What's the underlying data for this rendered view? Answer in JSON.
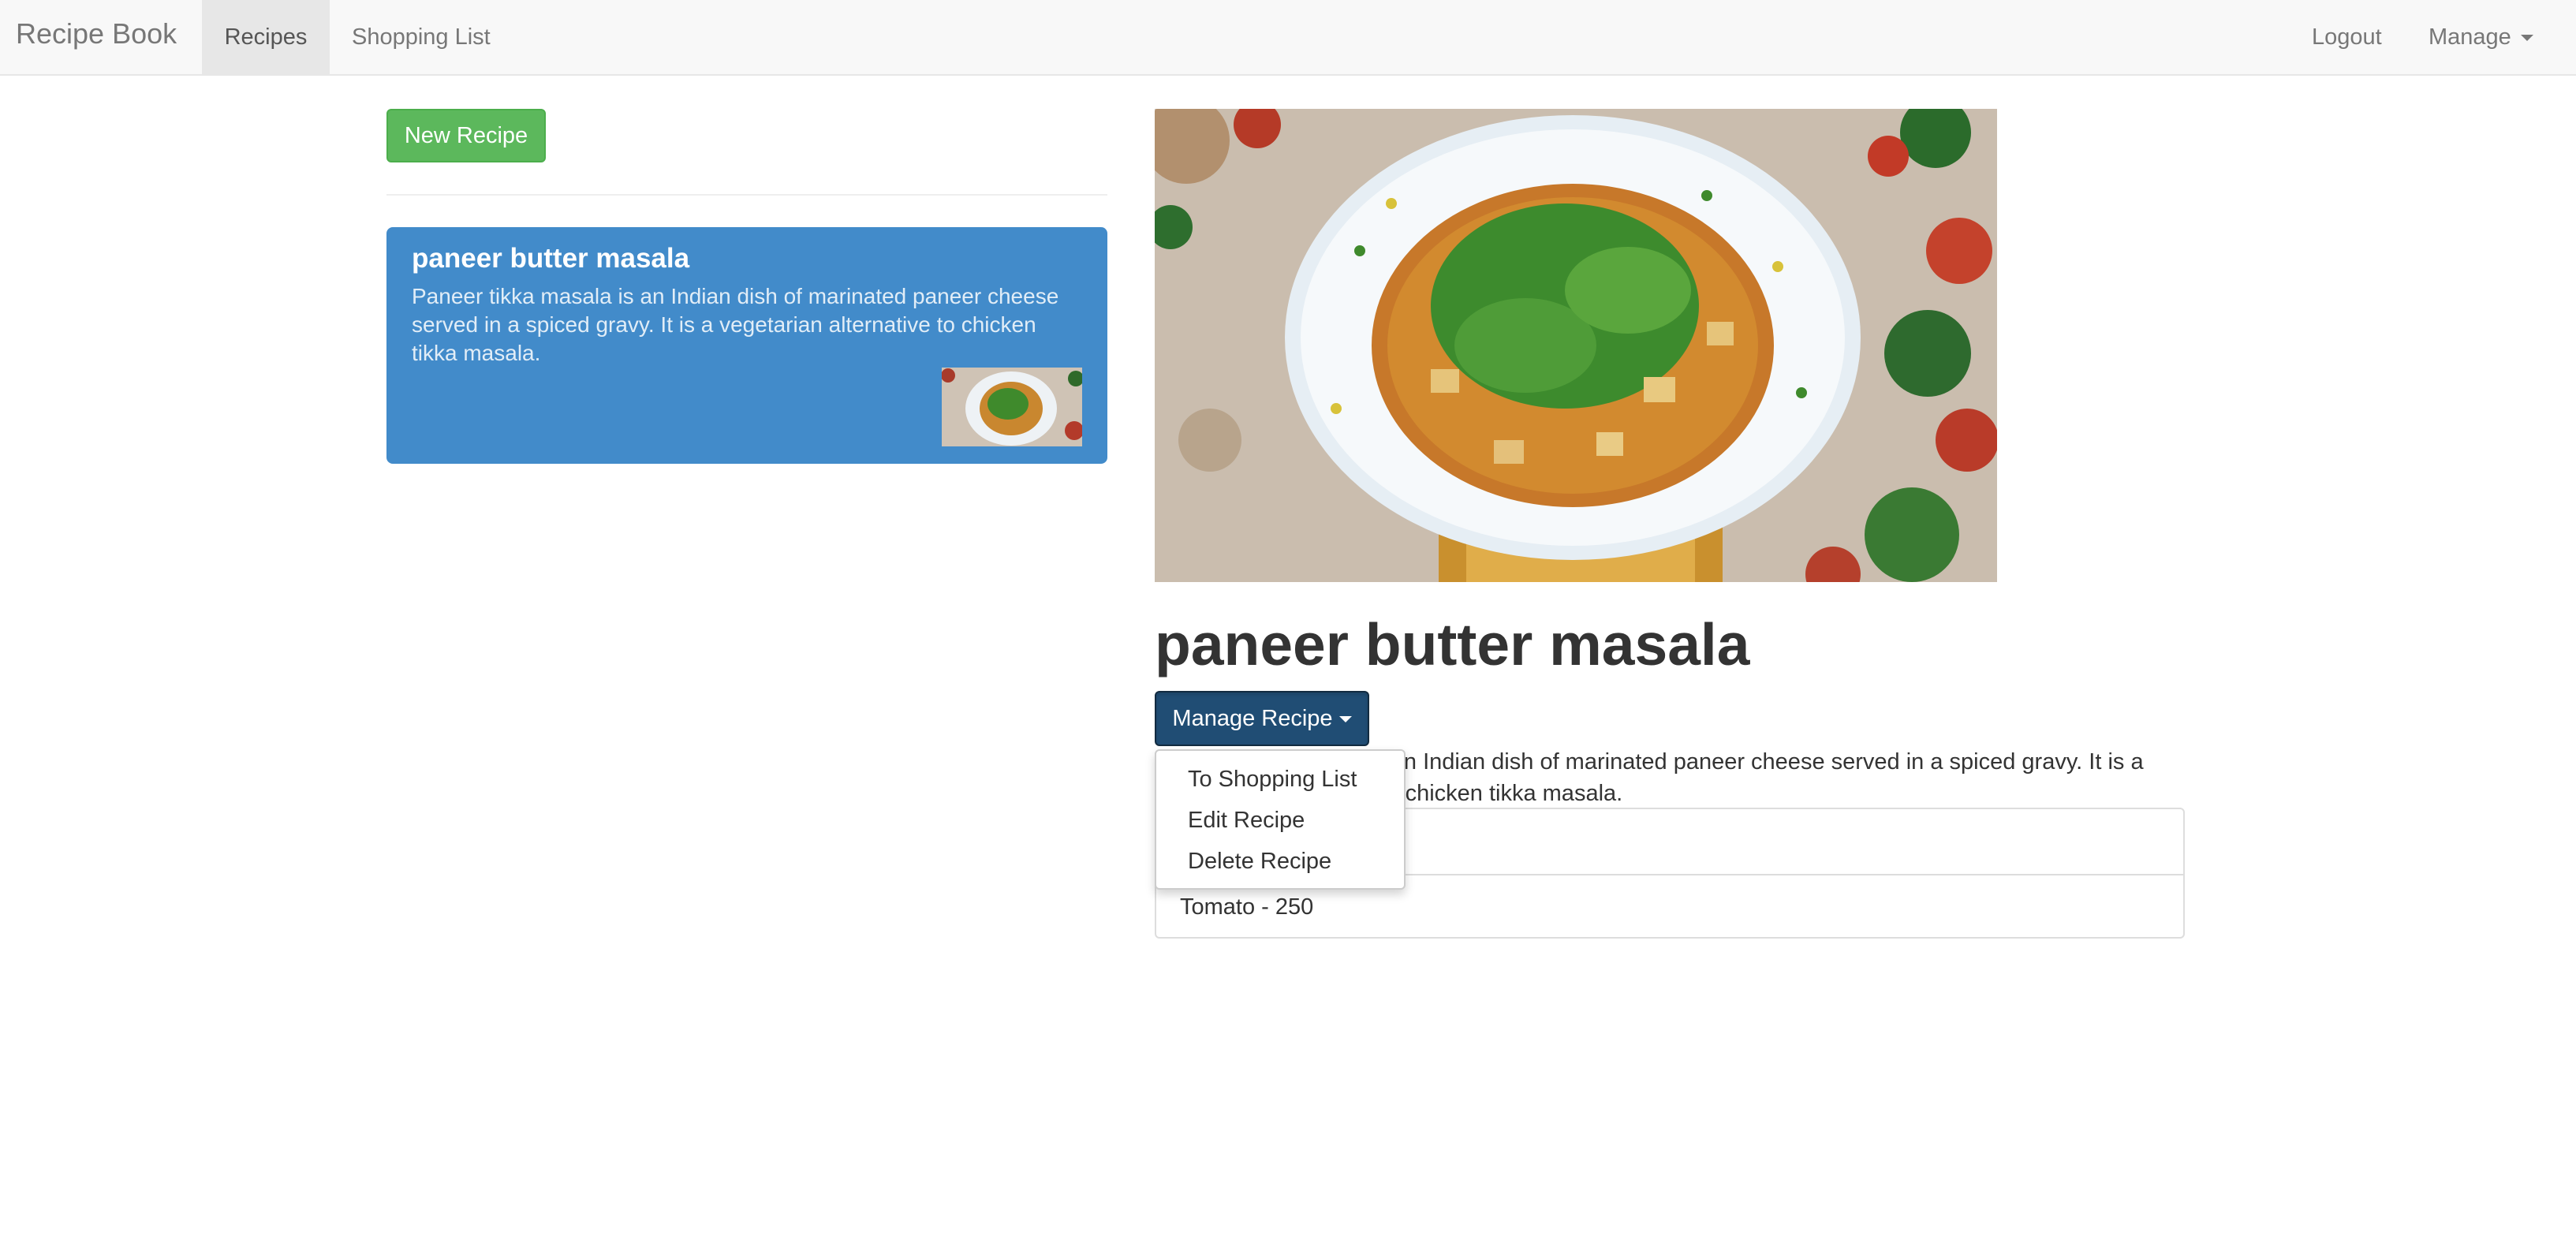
{
  "navbar": {
    "brand": "Recipe Book",
    "links": [
      {
        "label": "Recipes"
      },
      {
        "label": "Shopping List"
      }
    ],
    "logout": "Logout",
    "manage": "Manage"
  },
  "sidebar": {
    "new_recipe": "New Recipe",
    "recipes": [
      {
        "name": "paneer butter masala",
        "description": "Paneer tikka masala is an Indian dish of marinated paneer cheese served in a spiced gravy. It is a vegetarian alternative to chicken tikka masala."
      }
    ]
  },
  "detail": {
    "title": "paneer butter masala",
    "manage_button": "Manage Recipe",
    "description": "Paneer tikka masala is an Indian dish of marinated paneer cheese served in a spiced gravy. It is a vegetarian alternative to chicken tikka masala.",
    "ingredients": [
      {
        "label": ""
      },
      {
        "label": "Tomato - 250"
      }
    ],
    "dropdown": [
      {
        "label": "To Shopping List"
      },
      {
        "label": "Edit Recipe"
      },
      {
        "label": "Delete Recipe"
      }
    ]
  },
  "colors": {
    "card_bg": "#428bca",
    "new_button": "#5cb85c",
    "manage_button": "#204d74"
  }
}
